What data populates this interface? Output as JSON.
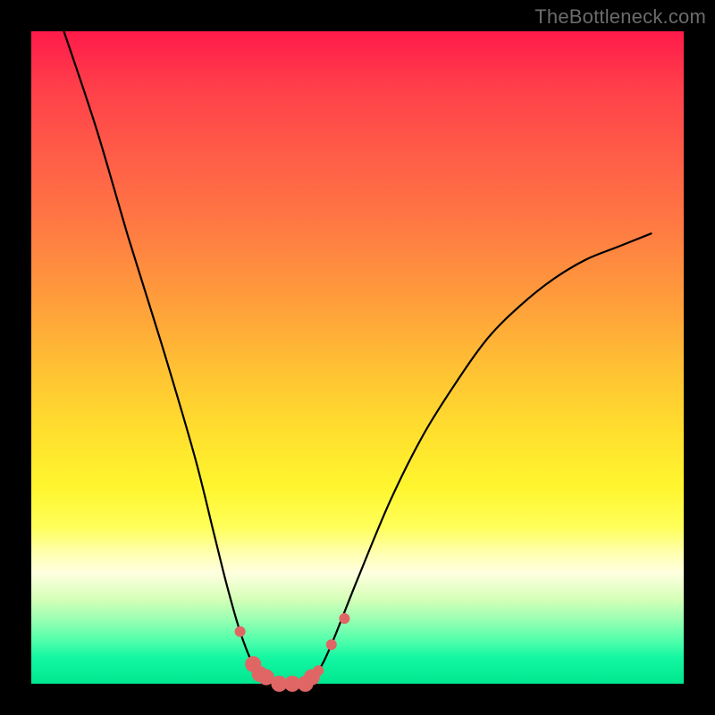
{
  "watermark": "TheBottleneck.com",
  "chart_data": {
    "type": "line",
    "title": "",
    "xlabel": "",
    "ylabel": "",
    "xlim": [
      0,
      100
    ],
    "ylim": [
      0,
      100
    ],
    "series": [
      {
        "name": "bottleneck-curve",
        "x": [
          5,
          10,
          15,
          20,
          25,
          28,
          30,
          32,
          34,
          36,
          38,
          40,
          42,
          44,
          46,
          50,
          55,
          60,
          65,
          70,
          75,
          80,
          85,
          90,
          95
        ],
        "values": [
          100,
          85,
          68,
          52,
          35,
          23,
          15,
          8,
          3,
          1,
          0,
          0,
          0,
          2,
          6,
          16,
          28,
          38,
          46,
          53,
          58,
          62,
          65,
          67,
          69
        ]
      }
    ],
    "markers": {
      "name": "highlighted-points",
      "x": [
        32,
        34,
        35,
        36,
        38,
        40,
        42,
        43,
        44,
        46,
        48
      ],
      "values": [
        8,
        3,
        1.5,
        1,
        0,
        0,
        0,
        1,
        2,
        6,
        10
      ],
      "color": "#e06666",
      "small_indices": [
        0,
        8,
        9,
        10
      ],
      "big_radius": 9,
      "small_radius": 6
    }
  }
}
